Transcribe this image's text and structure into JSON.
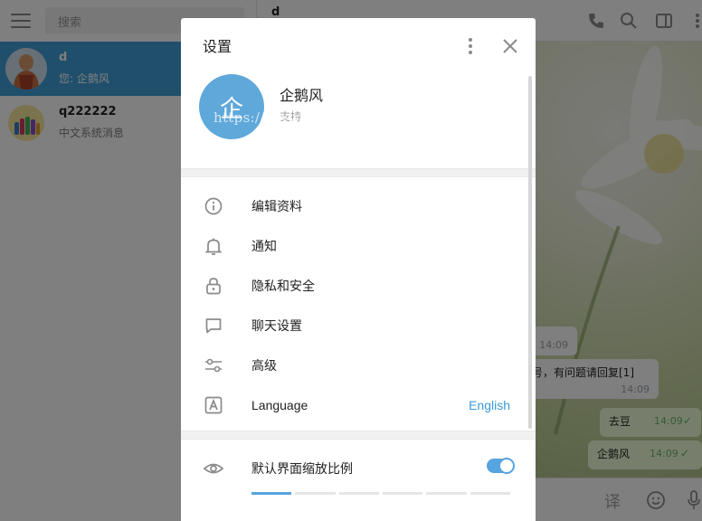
{
  "sidebar": {
    "search_placeholder": "搜索",
    "chats": [
      {
        "name": "d",
        "preview": "您: 企鹅风"
      },
      {
        "name": "q222222",
        "preview": "中文系统消息"
      }
    ]
  },
  "chat": {
    "title": "d",
    "messages": [
      {
        "text": "",
        "time": "14:09"
      },
      {
        "text": "号，有问题请回复[1]",
        "time": "14:09"
      },
      {
        "text": "去豆",
        "time": "14:09"
      },
      {
        "text": "企鹅风",
        "time": "14:09"
      }
    ],
    "composer_translate": "译"
  },
  "settings": {
    "title": "设置",
    "profile": {
      "avatar_letter": "企",
      "name": "企鹅风",
      "status": "支持"
    },
    "menu": [
      {
        "icon": "info-icon",
        "label": "编辑资料"
      },
      {
        "icon": "bell-icon",
        "label": "通知"
      },
      {
        "icon": "lock-icon",
        "label": "隐私和安全"
      },
      {
        "icon": "chat-bubble-icon",
        "label": "聊天设置"
      },
      {
        "icon": "sliders-icon",
        "label": "高级"
      },
      {
        "icon": "language-icon",
        "label": "Language",
        "value": "English"
      }
    ],
    "scale": {
      "label": "默认界面缩放比例",
      "enabled": true,
      "selected_index": 0,
      "steps": 6
    }
  },
  "watermark": "https://www.huzhan.com/ishop52469",
  "colors": {
    "accent": "#419fd9",
    "avatar": "#5fa8da",
    "toggle": "#56a4e0",
    "link": "#3b9ad8"
  }
}
